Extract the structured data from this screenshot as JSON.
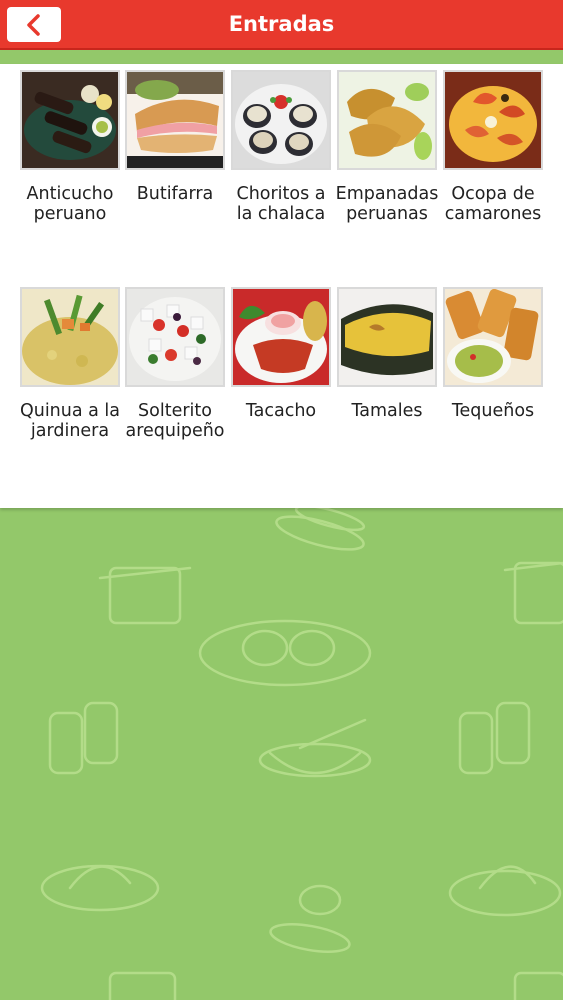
{
  "header": {
    "title": "Entradas",
    "accent": "#e8392d"
  },
  "background_color": "#93c86a",
  "items": [
    {
      "label": "Anticucho peruano",
      "icon": "anticucho-photo"
    },
    {
      "label": "Butifarra",
      "icon": "butifarra-photo"
    },
    {
      "label": "Choritos a la chalaca",
      "icon": "choritos-photo"
    },
    {
      "label": "Empanadas peruanas",
      "icon": "empanadas-photo"
    },
    {
      "label": "Ocopa de camarones",
      "icon": "ocopa-photo"
    },
    {
      "label": "Quinua a la jardinera",
      "icon": "quinua-photo"
    },
    {
      "label": "Solterito arequipeño",
      "icon": "solterito-photo"
    },
    {
      "label": "Tacacho",
      "icon": "tacacho-photo"
    },
    {
      "label": "Tamales",
      "icon": "tamales-photo"
    },
    {
      "label": "Tequeños",
      "icon": "tequenos-photo"
    }
  ]
}
